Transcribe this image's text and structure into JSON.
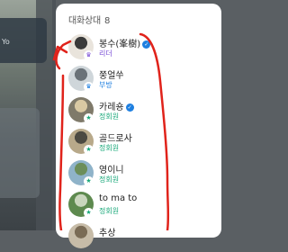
{
  "header": {
    "title": "대화상대",
    "count": "8"
  },
  "background": {
    "tab_text": "Yo"
  },
  "members": [
    {
      "name": "봉수(峯樹)",
      "verified": true,
      "role": "리더",
      "role_color": "#7b4fd6",
      "badge_icon": "crown-icon",
      "avatar_colors": [
        "#e9e4dc",
        "#3a3a3a"
      ]
    },
    {
      "name": "쭝얼쑤",
      "verified": false,
      "role": "부방",
      "role_color": "#1e7fe0",
      "badge_icon": "crown-icon",
      "avatar_colors": [
        "#cfd6da",
        "#6a7278"
      ]
    },
    {
      "name": "카레숑",
      "verified": true,
      "role": "정회원",
      "role_color": "#1aa87a",
      "badge_icon": "star-icon",
      "avatar_colors": [
        "#7f7a6a",
        "#d9c9a3"
      ]
    },
    {
      "name": "골드로사",
      "verified": false,
      "role": "정회원",
      "role_color": "#1aa87a",
      "badge_icon": "star-icon",
      "avatar_colors": [
        "#b8a98a",
        "#4c4a42"
      ]
    },
    {
      "name": "영이니",
      "verified": false,
      "role": "정회원",
      "role_color": "#1aa87a",
      "badge_icon": "star-icon",
      "avatar_colors": [
        "#8fb3c9",
        "#6c8e5a"
      ]
    },
    {
      "name": "to ma to",
      "verified": false,
      "role": "정회원",
      "role_color": "#1aa87a",
      "badge_icon": "star-icon",
      "avatar_colors": [
        "#5e8a4f",
        "#c9d6bd"
      ]
    },
    {
      "name": "추상",
      "verified": false,
      "role": "",
      "role_color": "#1aa87a",
      "badge_icon": "",
      "avatar_colors": [
        "#c7bca8",
        "#7a6b55"
      ]
    }
  ],
  "colors": {
    "annotation": "#e0231b",
    "verified": "#1e7fe0"
  }
}
